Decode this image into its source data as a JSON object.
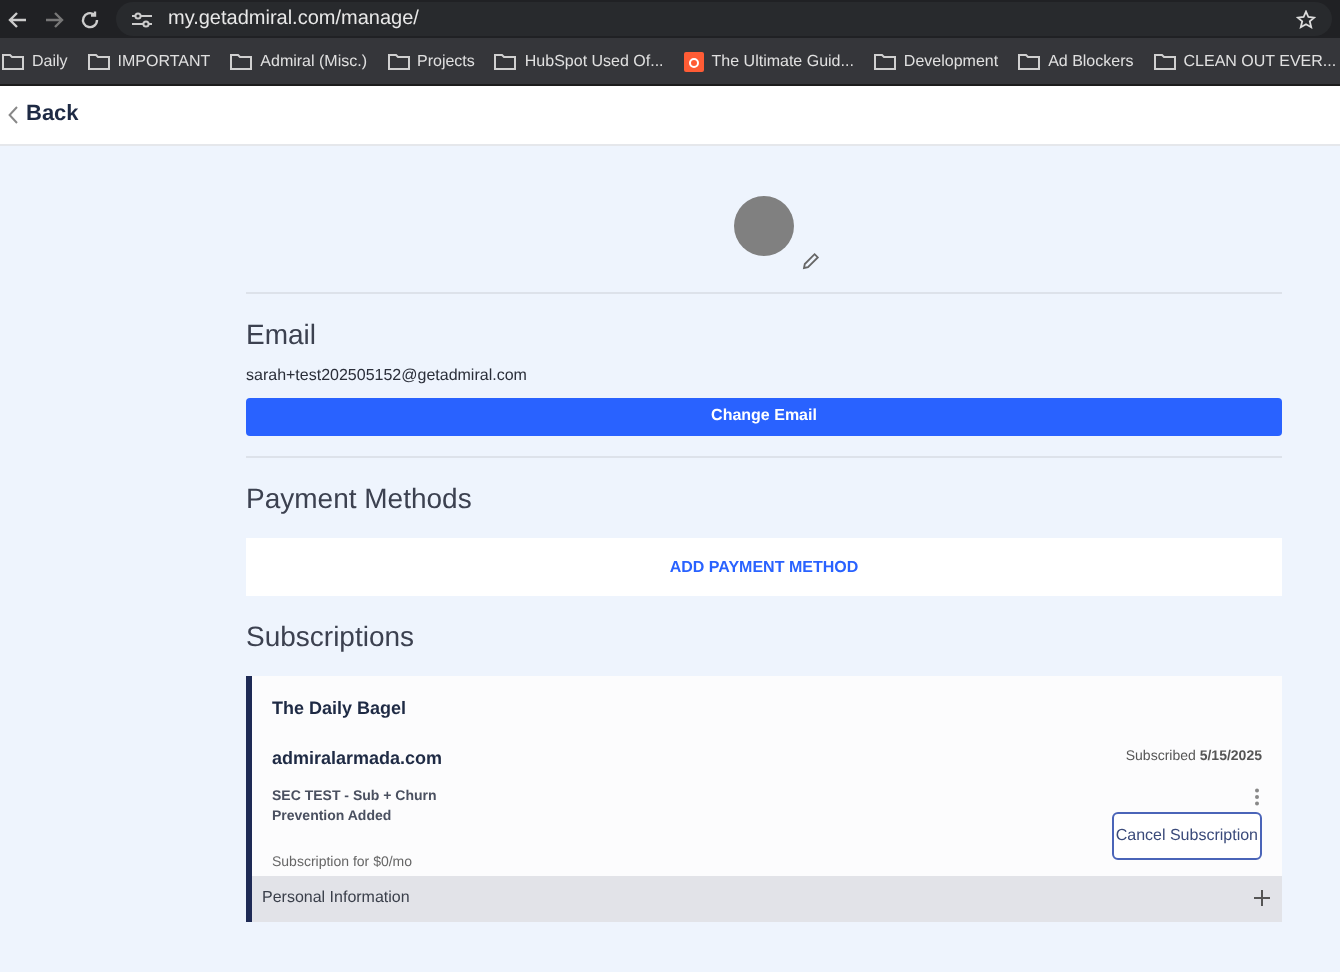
{
  "browser": {
    "url": "my.getadmiral.com/manage/"
  },
  "bookmarks": [
    {
      "label": "Daily",
      "kind": "folder"
    },
    {
      "label": "IMPORTANT",
      "kind": "folder"
    },
    {
      "label": "Admiral (Misc.)",
      "kind": "folder"
    },
    {
      "label": "Projects",
      "kind": "folder"
    },
    {
      "label": "HubSpot Used Of...",
      "kind": "folder"
    },
    {
      "label": "The Ultimate Guid...",
      "kind": "site"
    },
    {
      "label": "Development",
      "kind": "folder"
    },
    {
      "label": "Ad Blockers",
      "kind": "folder"
    },
    {
      "label": "CLEAN OUT EVER...",
      "kind": "folder"
    }
  ],
  "back": "Back",
  "email": {
    "heading": "Email",
    "value": "sarah+test202505152@getadmiral.com",
    "button": "Change Email"
  },
  "payment": {
    "heading": "Payment Methods",
    "button": "ADD PAYMENT METHOD"
  },
  "subscriptions": {
    "heading": "Subscriptions",
    "items": [
      {
        "title": "The Daily Bagel",
        "site": "admiralarmada.com",
        "subscribed": "Subscribed **5/15/2025**",
        "plan": "SEC TEST - Sub + Churn Prevention Added",
        "price": "Subscription for $0/mo",
        "cancel": "Cancel Subscription",
        "section": "Personal Information",
        "expanded": false
      }
    ]
  }
}
